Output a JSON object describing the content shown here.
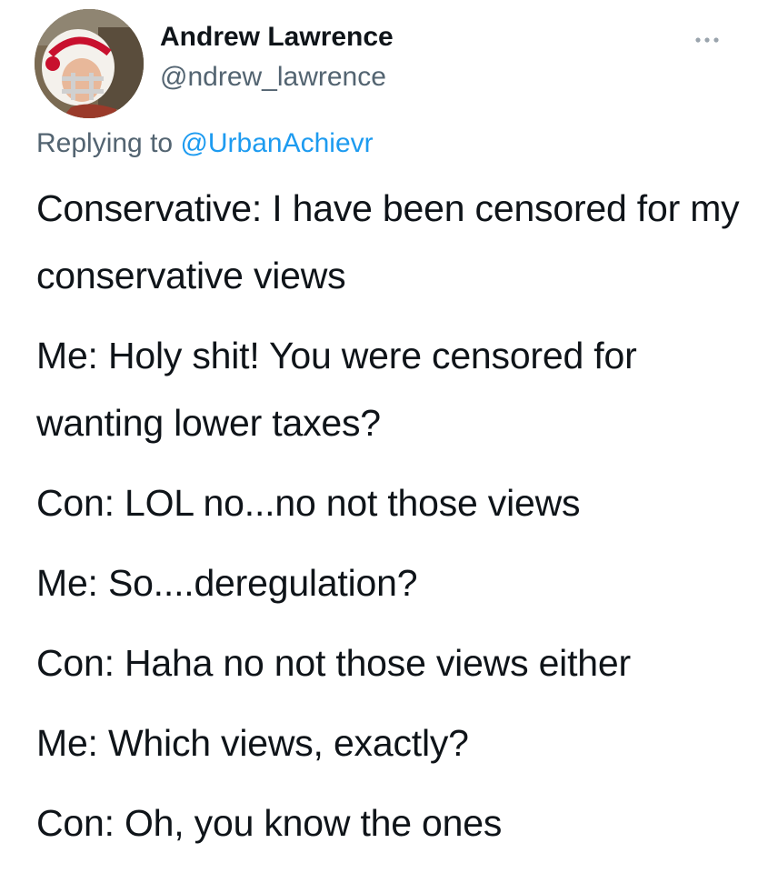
{
  "author": {
    "name": "Andrew Lawrence",
    "handle": "@ndrew_lawrence",
    "avatar_icon": "profile-photo-football-helmet"
  },
  "reply": {
    "prefix": "Replying to ",
    "mention": "@UrbanAchievr"
  },
  "menu": {
    "icon": "more-options-icon"
  },
  "colors": {
    "text": "#0f1419",
    "secondary": "#536471",
    "link": "#1d9bf0"
  },
  "tweet": {
    "paragraphs": [
      "Conservative: I have been censored for my conservative views",
      "Me: Holy shit! You were censored for wanting lower taxes?",
      "Con: LOL no...no not those views",
      "Me: So....deregulation?",
      "Con: Haha no not those views either",
      "Me: Which views, exactly?",
      "Con: Oh, you know the ones"
    ]
  }
}
